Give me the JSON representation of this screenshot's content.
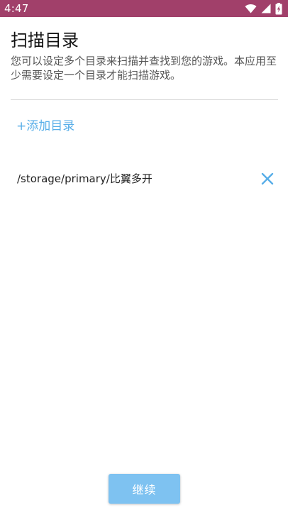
{
  "status_bar": {
    "time": "4:47",
    "icons": [
      "wifi-icon",
      "cell-signal-icon",
      "battery-charging-icon"
    ],
    "background_color": "#a1406a"
  },
  "header": {
    "title": "扫描目录",
    "description": "您可以设定多个目录来扫描并查找到您的游戏。本应用至少需要设定一个目录才能扫描游戏。"
  },
  "actions": {
    "add_directory_label": "+添加目录"
  },
  "directories": [
    {
      "path": "/storage/primary/比翼多开",
      "remove_icon": "close-icon"
    }
  ],
  "footer": {
    "continue_label": "继续"
  },
  "colors": {
    "accent": "#58aee8",
    "button": "#7ec2f1",
    "status_bar": "#a1406a"
  }
}
